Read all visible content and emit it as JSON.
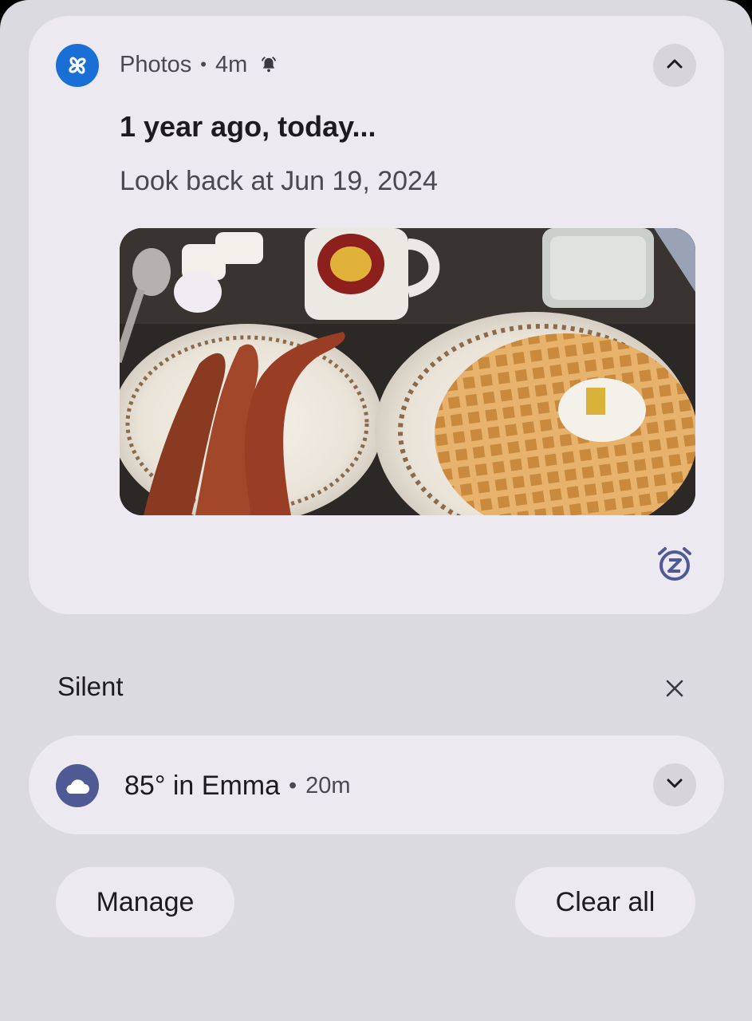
{
  "notification_photos": {
    "app_name": "Photos",
    "separator": "•",
    "time": "4m",
    "title": "1 year ago, today...",
    "text": "Look back at Jun 19, 2024",
    "image_description_icon": "memory-photo",
    "app_icon": "pinwheel-icon",
    "alert_icon": "bell-icon",
    "collapse_icon": "chevron-up-icon",
    "snooze_icon": "snooze-alarm-icon"
  },
  "silent_section": {
    "label": "Silent",
    "close_icon": "close-icon"
  },
  "notification_weather": {
    "title": "85° in Emma",
    "separator": "•",
    "time": "20m",
    "app_icon": "cloud-icon",
    "expand_icon": "chevron-down-icon"
  },
  "actions": {
    "manage_label": "Manage",
    "clear_all_label": "Clear all"
  },
  "colors": {
    "shade_background": "#dbdae0",
    "card_background": "#ece9f1",
    "photos_icon_blue": "#1a6fd6",
    "weather_icon_indigo": "#4f5a94",
    "snooze_icon_color": "#4f5a94"
  }
}
